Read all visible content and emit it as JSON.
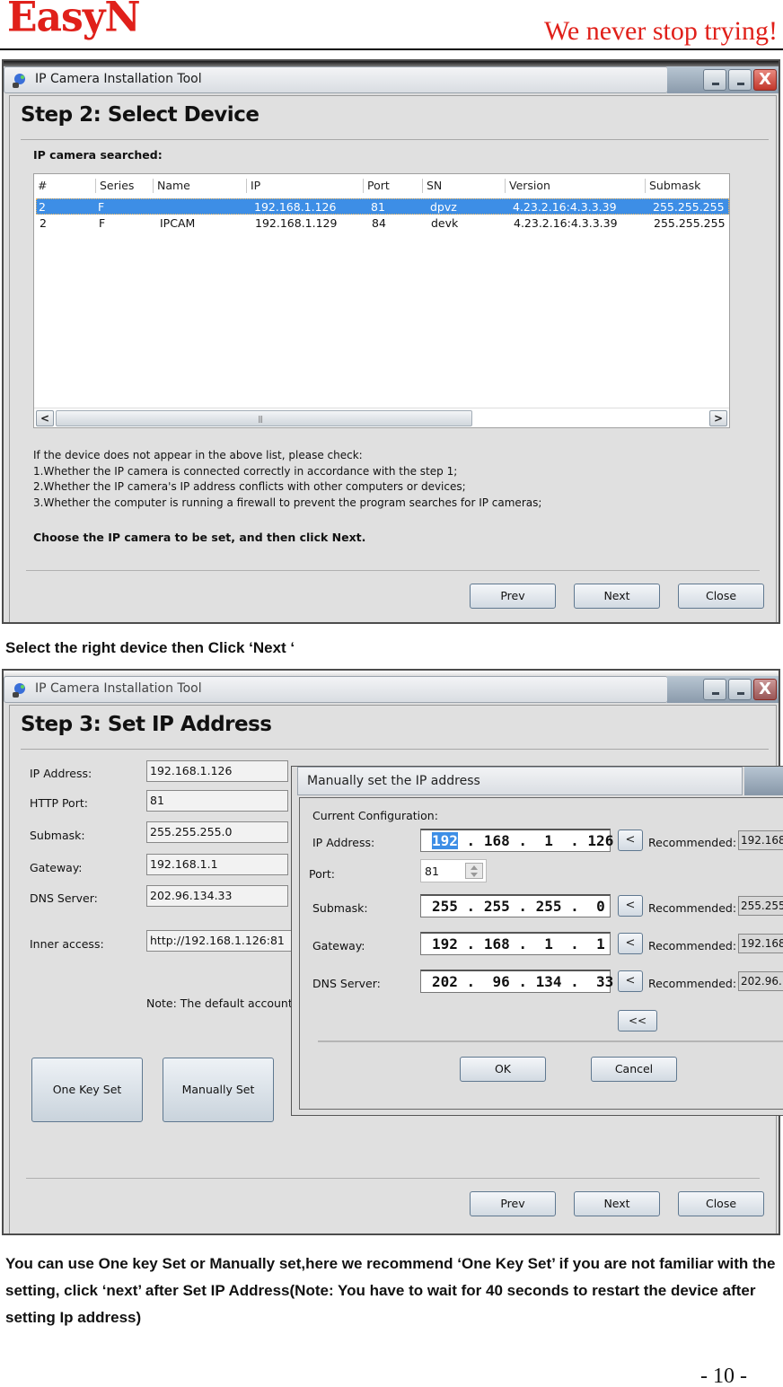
{
  "page_header": {
    "brand": "EasyN",
    "slogan": "We never stop trying!"
  },
  "window1": {
    "title": "IP Camera Installation Tool",
    "controls": {
      "minimize": "_",
      "restore": "_",
      "close": "X"
    },
    "step_title": "Step 2: Select Device",
    "section_label": "IP camera searched:",
    "table": {
      "columns": [
        "#",
        "Series",
        "Name",
        "IP",
        "Port",
        "SN",
        "Version",
        "Submask"
      ],
      "rows": [
        {
          "num": "2",
          "series": "F",
          "name": "",
          "ip": "192.168.1.126",
          "port": "81",
          "sn": "dpvz",
          "version": "4.23.2.16:4.3.3.39",
          "submask": "255.255.255",
          "selected": true
        },
        {
          "num": "2",
          "series": "F",
          "name": "IPCAM",
          "ip": "192.168.1.129",
          "port": "84",
          "sn": "devk",
          "version": "4.23.2.16:4.3.3.39",
          "submask": "255.255.255",
          "selected": false
        }
      ],
      "scroll_left": "<",
      "scroll_right": ">",
      "scroll_grip": "|||"
    },
    "info_lines": [
      "If the device does not appear in the above list, please check:",
      "1.Whether the IP camera is connected correctly in accordance with the step 1;",
      "2.Whether the IP camera's IP address conflicts with other computers or devices;",
      "3.Whether the computer is running a firewall to prevent the program searches for IP cameras;"
    ],
    "instruction": "Choose the IP camera to be set, and then click Next.",
    "buttons": {
      "prev": "Prev",
      "next": "Next",
      "close": "Close"
    }
  },
  "caption1": "Select the right device then Click ‘Next ‘",
  "window2": {
    "title": "IP Camera Installation Tool",
    "controls": {
      "minimize": "_",
      "restore": "_",
      "close": "X"
    },
    "step_title": "Step 3: Set IP Address",
    "form": {
      "ip_label": "IP Address:",
      "ip_value": "192.168.1.126",
      "port_label": "HTTP Port:",
      "port_value": "81",
      "submask_label": "Submask:",
      "submask_value": "255.255.255.0",
      "gateway_label": "Gateway:",
      "gateway_value": "192.168.1.1",
      "dns_label": "DNS Server:",
      "dns_value": "202.96.134.33",
      "inner_label": "Inner access:",
      "inner_value": "http://192.168.1.126:81",
      "note": "Note: The default account"
    },
    "one_key_set": "One Key Set",
    "manually_set": "Manually Set",
    "buttons": {
      "prev": "Prev",
      "next": "Next",
      "close": "Close"
    },
    "dialog": {
      "title": "Manually set the IP address",
      "section_label": "Current Configuration:",
      "ip_label": "IP Address:",
      "ip_octets": [
        "192",
        "168",
        "1",
        "126"
      ],
      "port_label": "Port:",
      "port_value": "81",
      "submask_label": "Submask:",
      "submask_octets": [
        "255",
        "255",
        "255",
        "0"
      ],
      "gateway_label": "Gateway:",
      "gateway_octets": [
        "192",
        "168",
        "1",
        "1"
      ],
      "dns_label": "DNS Server:",
      "dns_octets": [
        "202",
        "96",
        "134",
        "33"
      ],
      "copy_button": "<",
      "recommended_label": "Recommended:",
      "recommended": {
        "ip": "192.168",
        "submask": "255.255",
        "gateway": "192.168",
        "dns": "202.96."
      },
      "collapse_button": "<<",
      "ok": "OK",
      "cancel": "Cancel"
    }
  },
  "paragraph": "You can use One key Set or Manually set,here we recommend ‘One Key Set’ if you are not familiar with the setting, click ‘next’ after Set IP Address(Note: You have to wait for 40 seconds to restart the device after setting Ip address)",
  "page_number": "- 10 -"
}
